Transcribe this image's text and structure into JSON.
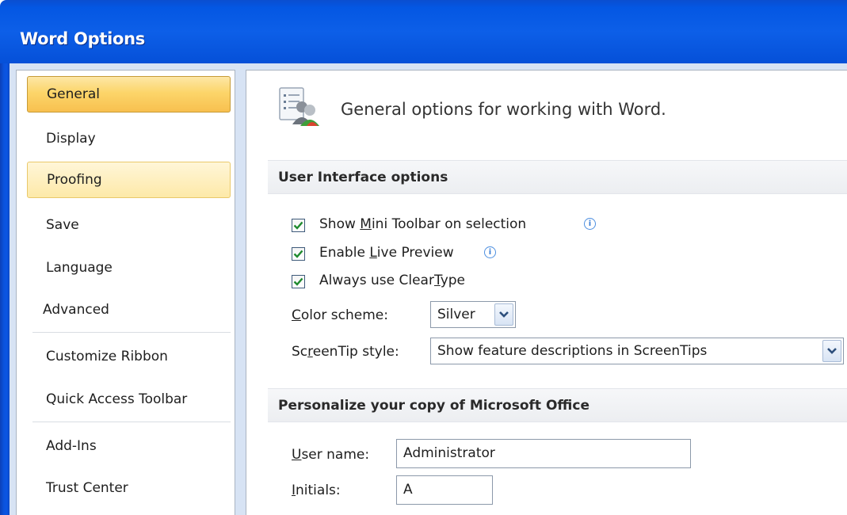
{
  "window": {
    "title": "Word Options"
  },
  "nav": {
    "items": [
      {
        "label": "General",
        "state": "selected"
      },
      {
        "label": "Display",
        "state": "normal"
      },
      {
        "label": "Proofing",
        "state": "hover"
      },
      {
        "label": "Save",
        "state": "normal"
      },
      {
        "label": "Language",
        "state": "normal"
      },
      {
        "label": "Advanced",
        "state": "normal"
      },
      {
        "label": "Customize Ribbon",
        "state": "normal"
      },
      {
        "label": "Quick Access Toolbar",
        "state": "normal"
      },
      {
        "label": "Add-Ins",
        "state": "normal"
      },
      {
        "label": "Trust Center",
        "state": "normal"
      }
    ]
  },
  "main": {
    "heading": "General options for working with Word.",
    "ui_section": {
      "title": "User Interface options",
      "checkboxes": [
        {
          "pre": "Show ",
          "key": "M",
          "post": "ini Toolbar on selection",
          "checked": true,
          "info": true
        },
        {
          "pre": "Enable ",
          "key": "L",
          "post": "ive Preview",
          "checked": true,
          "info": true
        },
        {
          "pre": "Always use Clear",
          "key": "T",
          "post": "ype",
          "checked": true,
          "info": false
        }
      ],
      "color_scheme": {
        "pre": "",
        "key": "C",
        "post": "olor scheme:",
        "value": "Silver"
      },
      "screentip_style": {
        "pre": "Sc",
        "key": "r",
        "post": "eenTip style:",
        "value": "Show feature descriptions in ScreenTips"
      }
    },
    "personalize_section": {
      "title": "Personalize your copy of Microsoft Office",
      "user_name": {
        "pre": "",
        "key": "U",
        "post": "ser name:",
        "value": "Administrator"
      },
      "initials": {
        "pre": "",
        "key": "I",
        "post": "nitials:",
        "value": "A"
      }
    }
  },
  "colors": {
    "title_bar": "#0457e3",
    "selected_nav": "#fcd56a",
    "hover_nav": "#fde9a8",
    "check_mark": "#1f8a2e"
  }
}
